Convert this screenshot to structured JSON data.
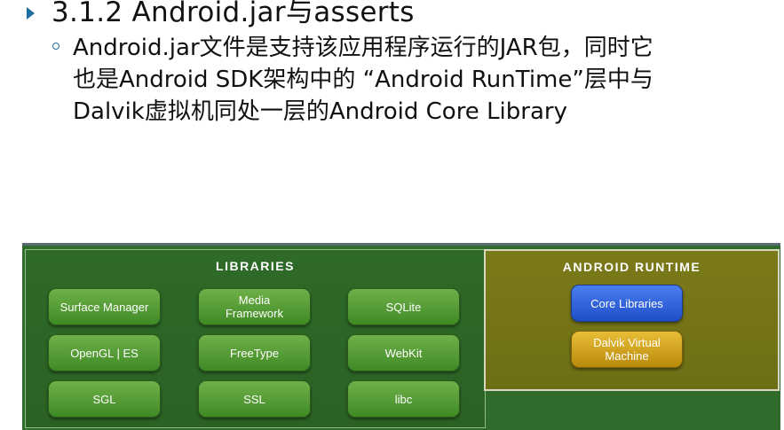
{
  "heading": "3.1.2 Android.jar与asserts",
  "bullet_lines": [
    "Android.jar文件是支持该应用程序运行的JAR包，同时它",
    "也是Android SDK架构中的 “Android RunTime”层中与",
    "Dalvik虚拟机同处一层的Android Core Library"
  ],
  "diagram": {
    "libraries": {
      "title": "Libraries",
      "items": [
        [
          "Surface Manager"
        ],
        [
          "Media",
          "Framework"
        ],
        [
          "SQLite"
        ],
        [
          "OpenGL | ES"
        ],
        [
          "FreeType"
        ],
        [
          "WebKit"
        ],
        [
          "SGL"
        ],
        [
          "SSL"
        ],
        [
          "libc"
        ]
      ]
    },
    "runtime": {
      "title": "Android Runtime",
      "core": "Core Libraries",
      "vm_line1": "Dalvik Virtual",
      "vm_line2": "Machine"
    }
  },
  "colors": {
    "bullet": "#1f6ea3",
    "libraries_bg": "#2e6a28",
    "runtime_bg": "#7b7a1a",
    "library_button": "#4f9a34",
    "core_button": "#2f62e0",
    "vm_button": "#d4a423"
  }
}
